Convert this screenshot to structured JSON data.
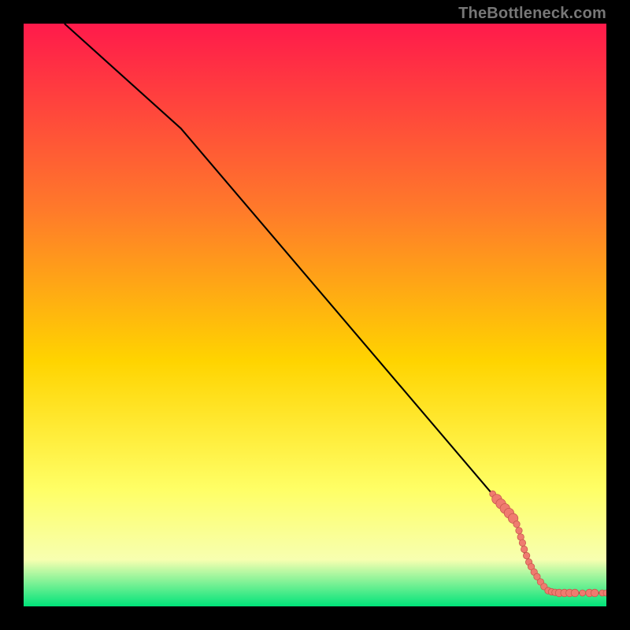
{
  "attribution": "TheBottleneck.com",
  "colors": {
    "gradient_top": "#ff1a4b",
    "gradient_mid1": "#ff7a2a",
    "gradient_mid2": "#ffd400",
    "gradient_mid3": "#ffff66",
    "gradient_mid4": "#f7ffb0",
    "gradient_bottom": "#00e37a",
    "line": "#000000",
    "marker_fill": "#ef7b6f",
    "marker_stroke": "#c85a4e",
    "frame": "#000000"
  },
  "chart_data": {
    "type": "line",
    "title": "",
    "xlabel": "",
    "ylabel": "",
    "xlim": [
      0,
      100
    ],
    "ylim": [
      0,
      100
    ],
    "grid": false,
    "legend": false,
    "series": [
      {
        "name": "curve",
        "kind": "line",
        "x": [
          7,
          27,
          84.5,
          86,
          90,
          100
        ],
        "y": [
          100,
          82,
          14.5,
          9,
          2.3,
          2.3
        ]
      },
      {
        "name": "markers",
        "kind": "scatter",
        "points": [
          {
            "x": 80.5,
            "y": 19.3,
            "r": 4.0
          },
          {
            "x": 81.2,
            "y": 18.4,
            "r": 6.2
          },
          {
            "x": 81.9,
            "y": 17.6,
            "r": 6.2
          },
          {
            "x": 82.6,
            "y": 16.8,
            "r": 6.2
          },
          {
            "x": 83.3,
            "y": 16.0,
            "r": 6.2
          },
          {
            "x": 84.0,
            "y": 15.1,
            "r": 6.2
          },
          {
            "x": 84.6,
            "y": 14.1,
            "r": 4.2
          },
          {
            "x": 85.0,
            "y": 13.0,
            "r": 4.2
          },
          {
            "x": 85.3,
            "y": 11.9,
            "r": 4.2
          },
          {
            "x": 85.6,
            "y": 10.9,
            "r": 4.2
          },
          {
            "x": 85.9,
            "y": 9.8,
            "r": 4.2
          },
          {
            "x": 86.3,
            "y": 8.7,
            "r": 4.2
          },
          {
            "x": 86.7,
            "y": 7.6,
            "r": 4.2
          },
          {
            "x": 87.1,
            "y": 6.8,
            "r": 4.2
          },
          {
            "x": 87.6,
            "y": 5.9,
            "r": 4.2
          },
          {
            "x": 88.1,
            "y": 5.1,
            "r": 4.2
          },
          {
            "x": 88.7,
            "y": 4.2,
            "r": 4.2
          },
          {
            "x": 89.3,
            "y": 3.4,
            "r": 4.2
          },
          {
            "x": 90.0,
            "y": 2.7,
            "r": 4.2
          },
          {
            "x": 90.6,
            "y": 2.5,
            "r": 4.2
          },
          {
            "x": 91.2,
            "y": 2.4,
            "r": 4.2
          },
          {
            "x": 91.9,
            "y": 2.3,
            "r": 4.8
          },
          {
            "x": 92.8,
            "y": 2.3,
            "r": 4.8
          },
          {
            "x": 93.7,
            "y": 2.3,
            "r": 4.8
          },
          {
            "x": 94.6,
            "y": 2.3,
            "r": 4.8
          },
          {
            "x": 95.9,
            "y": 2.3,
            "r": 4.0
          },
          {
            "x": 97.1,
            "y": 2.3,
            "r": 4.8
          },
          {
            "x": 98.0,
            "y": 2.3,
            "r": 4.8
          },
          {
            "x": 99.3,
            "y": 2.3,
            "r": 4.0
          },
          {
            "x": 100.0,
            "y": 2.3,
            "r": 4.0
          }
        ]
      }
    ]
  }
}
